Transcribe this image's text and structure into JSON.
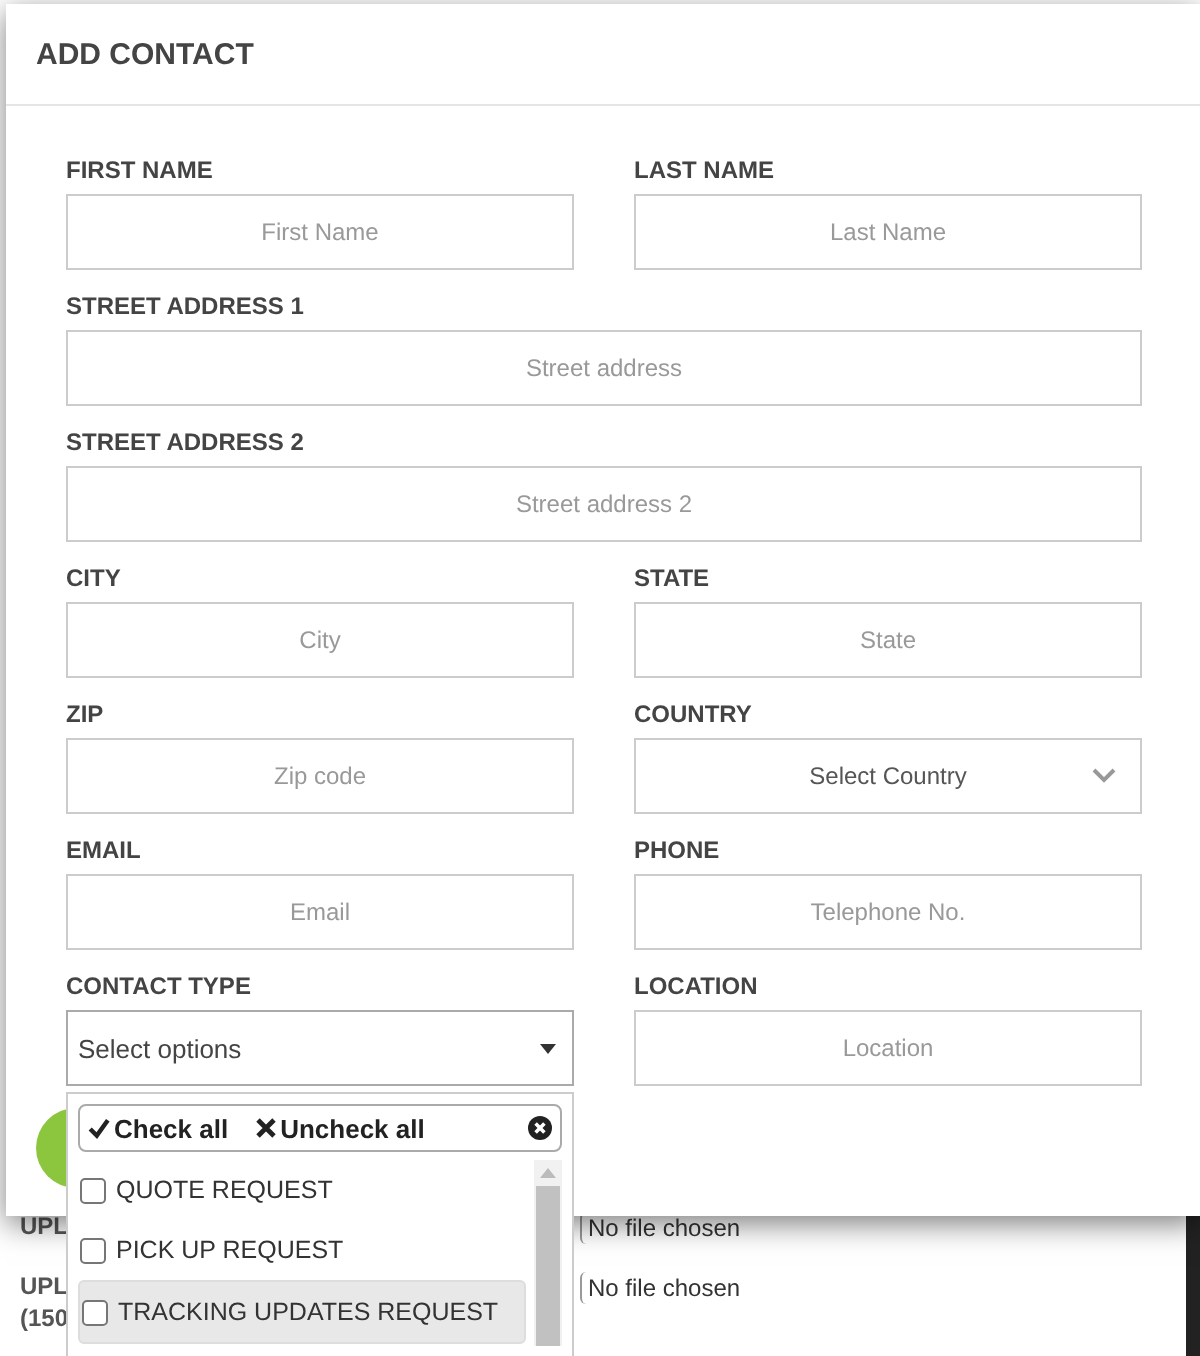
{
  "background": {
    "upload_rows": [
      {
        "label": "UPL",
        "file_status": "No file chosen"
      },
      {
        "label": "UPL",
        "note": "(150",
        "file_status": "No file chosen"
      }
    ]
  },
  "dialog": {
    "title": "ADD CONTACT",
    "fields": [
      {
        "label": "FIRST NAME",
        "placeholder": "First Name",
        "kind": "text"
      },
      {
        "label": "LAST NAME",
        "placeholder": "Last Name",
        "kind": "text"
      },
      {
        "label": "STREET ADDRESS 1",
        "placeholder": "Street address",
        "kind": "text",
        "wide": true
      },
      {
        "label": "STREET ADDRESS 2",
        "placeholder": "Street address 2",
        "kind": "text",
        "wide": true
      },
      {
        "label": "CITY",
        "placeholder": "City",
        "kind": "text"
      },
      {
        "label": "STATE",
        "placeholder": "State",
        "kind": "text"
      },
      {
        "label": "ZIP",
        "placeholder": "Zip code",
        "kind": "text"
      },
      {
        "label": "COUNTRY",
        "value": "Select Country",
        "kind": "select"
      },
      {
        "label": "EMAIL",
        "placeholder": "Email",
        "kind": "text"
      },
      {
        "label": "PHONE",
        "placeholder": "Telephone No.",
        "kind": "text"
      },
      {
        "label": "CONTACT TYPE",
        "value": "Select options",
        "kind": "multiselect"
      },
      {
        "label": "LOCATION",
        "placeholder": "Location",
        "kind": "text"
      }
    ],
    "multiselect_menu": {
      "check_all": "Check all",
      "uncheck_all": "Uncheck all",
      "options": [
        {
          "label": "QUOTE REQUEST",
          "checked": false,
          "highlighted": false
        },
        {
          "label": "PICK UP REQUEST",
          "checked": false,
          "highlighted": false
        },
        {
          "label": "TRACKING UPDATES REQUEST",
          "checked": false,
          "highlighted": true
        }
      ]
    }
  }
}
